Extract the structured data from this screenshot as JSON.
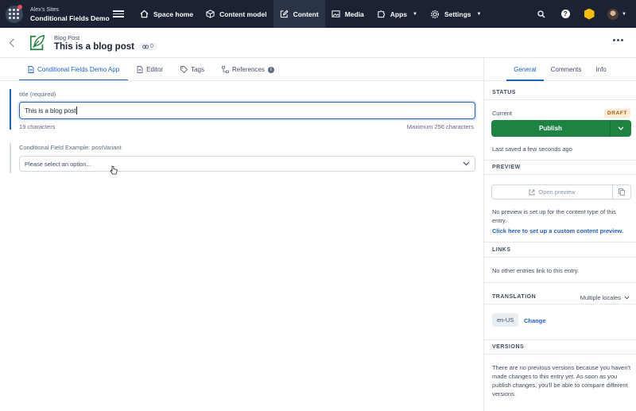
{
  "topnav": {
    "org": "Alex's Sites",
    "space": "Conditional Fields Demo",
    "items": [
      {
        "label": "Space home",
        "icon": "house-icon"
      },
      {
        "label": "Content model",
        "icon": "cube-icon"
      },
      {
        "label": "Content",
        "icon": "pencil-square-icon"
      },
      {
        "label": "Media",
        "icon": "image-icon"
      },
      {
        "label": "Apps",
        "icon": "puzzle-icon"
      },
      {
        "label": "Settings",
        "icon": "gear-icon"
      }
    ],
    "help": "?"
  },
  "entry": {
    "type": "Blog Post",
    "title": "This is a blog post",
    "ref_count": "0"
  },
  "tabs": [
    {
      "label": "Conditional Fields Demo App"
    },
    {
      "label": "Editor"
    },
    {
      "label": "Tags"
    },
    {
      "label": "References"
    }
  ],
  "fields": {
    "title": {
      "label": "title (required)",
      "value": "This is a blog post",
      "char_count": "19 characters",
      "max": "Maximum 256 characters"
    },
    "variant": {
      "label": "Conditional Field Example: postVariant",
      "placeholder": "Please select an option..."
    }
  },
  "sidebar": {
    "tabs": [
      "General",
      "Comments",
      "Info"
    ],
    "status": {
      "heading": "STATUS",
      "current_label": "Current",
      "badge": "DRAFT",
      "publish": "Publish",
      "saved": "Last saved a few seconds ago"
    },
    "preview": {
      "heading": "PREVIEW",
      "button": "Open preview",
      "note": "No preview is set up for the content type of this entry.",
      "link": "Click here to set up a custom content preview."
    },
    "links": {
      "heading": "LINKS",
      "note": "No other entries link to this entry."
    },
    "translation": {
      "heading": "TRANSLATION",
      "dropdown": "Multiple locales",
      "locale": "en-US",
      "change": "Change"
    },
    "versions": {
      "heading": "VERSIONS",
      "note": "There are no previous versions because you haven't made changes to this entry yet. As soon as you publish changes, you'll be able to compare different versions."
    }
  },
  "colors": {
    "nav_bg": "#1a2233",
    "accent": "#1f62c9",
    "publish_green": "#1c8343",
    "draft_bg": "#fcecd2",
    "draft_text": "#a9570f"
  }
}
